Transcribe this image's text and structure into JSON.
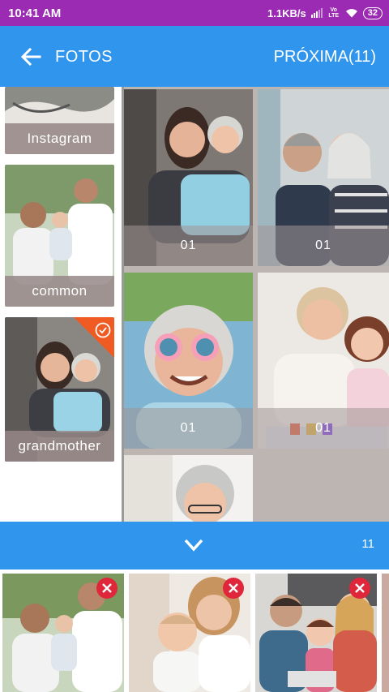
{
  "status": {
    "time": "10:41 AM",
    "network_speed": "1.1KB/s",
    "volte": "Vo LTE",
    "battery": "32"
  },
  "appbar": {
    "title": "FOTOS",
    "next_label": "PRÓXIMA(11)"
  },
  "albums": [
    {
      "label": "Instagram"
    },
    {
      "label": "common"
    },
    {
      "label": "grandmother",
      "selected": true
    }
  ],
  "photos": [
    {
      "count": "01"
    },
    {
      "count": "01"
    },
    {
      "count": "01"
    },
    {
      "count": "01"
    }
  ],
  "selection_bar": {
    "count": "11"
  },
  "colors": {
    "status_bar": "#9c2bb4",
    "primary": "#2f95ed",
    "selected_corner": "#f05a23",
    "remove": "#e0263a"
  },
  "icons": [
    "back-arrow-icon",
    "chevron-down-icon",
    "check-circle-icon",
    "close-icon",
    "signal-icon",
    "wifi-icon",
    "battery-icon"
  ]
}
